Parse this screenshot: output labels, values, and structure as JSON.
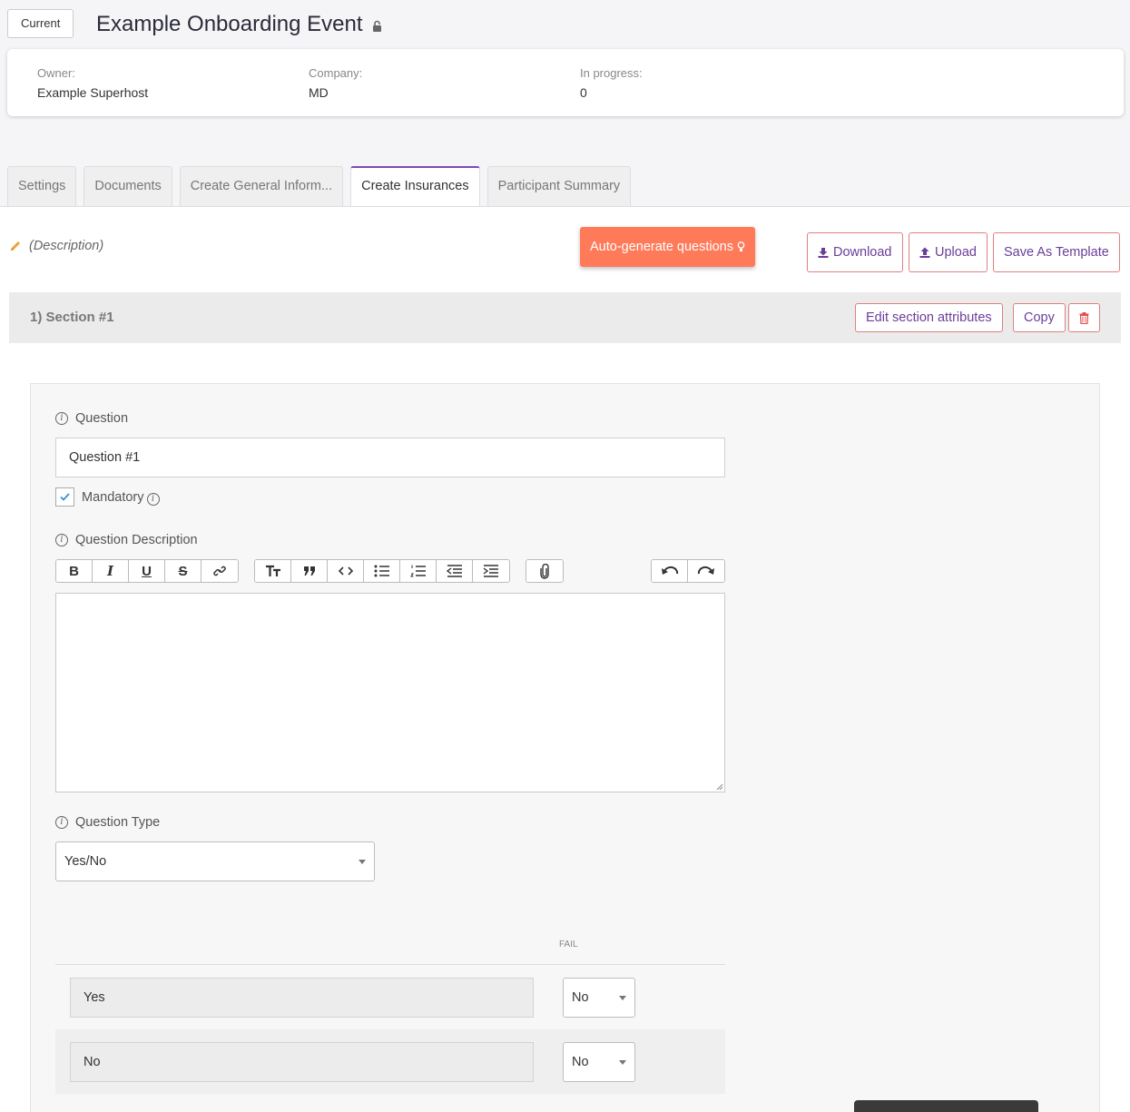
{
  "header": {
    "status_label": "Current",
    "title": "Example Onboarding Event",
    "lock_icon": "lock-icon"
  },
  "info": {
    "owner_label": "Owner:",
    "owner_value": "Example Superhost",
    "company_label": "Company:",
    "company_value": "MD",
    "progress_label": "In progress:",
    "progress_value": "0"
  },
  "tabs": [
    {
      "label": "Settings",
      "active": false
    },
    {
      "label": "Documents",
      "active": false
    },
    {
      "label": "Create General Inform...",
      "active": false
    },
    {
      "label": "Create Insurances",
      "active": true
    },
    {
      "label": "Participant Summary",
      "active": false
    }
  ],
  "toolbar": {
    "description": "(Description)",
    "auto_generate_label": "Auto-generate questions",
    "download_label": "Download",
    "upload_label": "Upload",
    "save_template_label": "Save As Template"
  },
  "section": {
    "title": "1) Section #1",
    "edit_label": "Edit section attributes",
    "copy_label": "Copy"
  },
  "question": {
    "question_label": "Question",
    "question_value": "Question #1",
    "mandatory_label": "Mandatory",
    "mandatory_checked": true,
    "description_label": "Question Description",
    "type_label": "Question Type",
    "type_value": "Yes/No",
    "fail_header": "FAIL",
    "answers": [
      {
        "answer": "Yes",
        "fail": "No"
      },
      {
        "answer": "No",
        "fail": "No"
      }
    ]
  },
  "colors": {
    "accent_purple": "#7b4bb8",
    "auto_button": "#ff7a59",
    "outline_border": "#e08080",
    "button_text": "#6a3d9a"
  }
}
